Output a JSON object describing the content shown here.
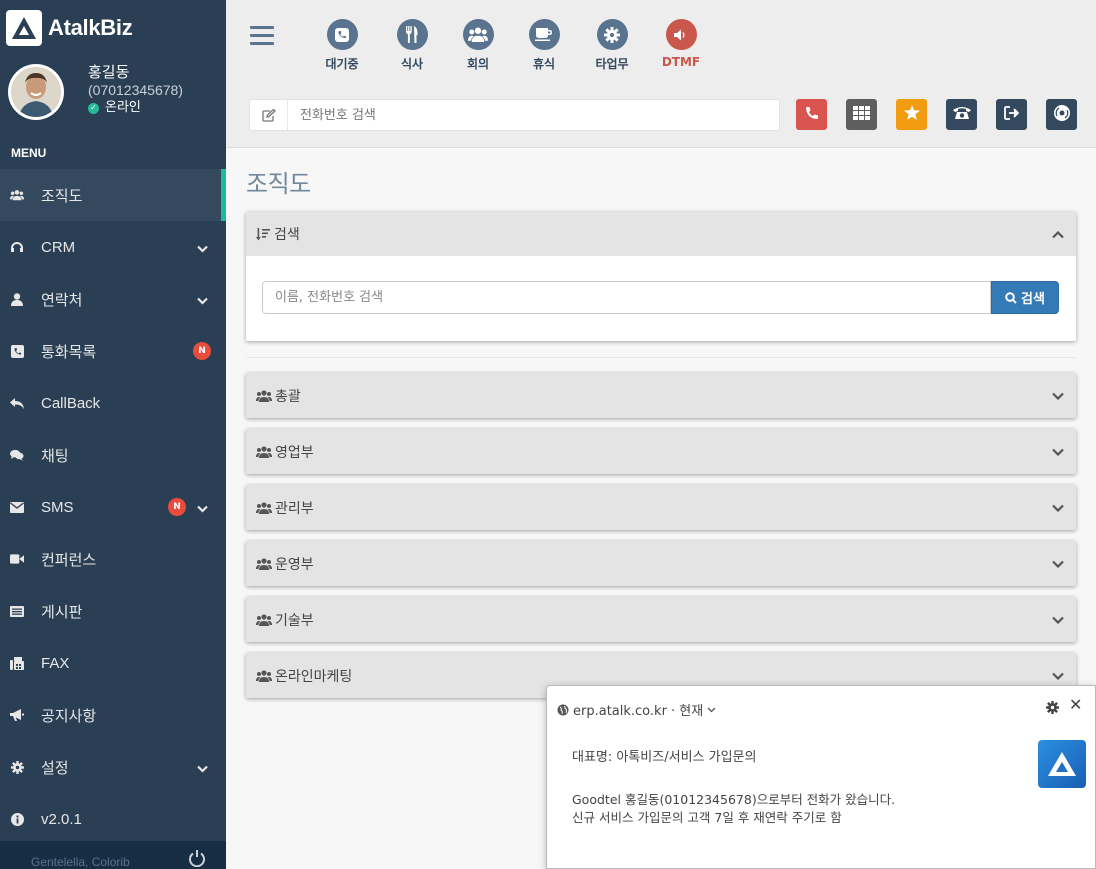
{
  "brand": {
    "name": "AtalkBiz"
  },
  "profile": {
    "name": "홍길동",
    "phone": "(07012345678)",
    "status": "온라인"
  },
  "menu": {
    "title": "MENU",
    "items": [
      {
        "label": "조직도",
        "icon": "users-icon",
        "active": true
      },
      {
        "label": "CRM",
        "icon": "headset-icon",
        "chevron": true
      },
      {
        "label": "연락처",
        "icon": "user-icon",
        "chevron": true
      },
      {
        "label": "통화목록",
        "icon": "phone-square-icon",
        "badge": "N"
      },
      {
        "label": "CallBack",
        "icon": "reply-icon"
      },
      {
        "label": "채팅",
        "icon": "comments-icon"
      },
      {
        "label": "SMS",
        "icon": "envelope-icon",
        "badge": "N",
        "chevron": true
      },
      {
        "label": "컨퍼런스",
        "icon": "video-icon"
      },
      {
        "label": "게시판",
        "icon": "list-alt-icon"
      },
      {
        "label": "FAX",
        "icon": "fax-icon"
      },
      {
        "label": "공지사항",
        "icon": "bullhorn-icon"
      },
      {
        "label": "설정",
        "icon": "gear-icon",
        "chevron": true
      },
      {
        "label": "v2.0.1",
        "icon": "info-icon"
      }
    ]
  },
  "footer": {
    "text": "Gentelella, Colorib"
  },
  "statuses": [
    {
      "label": "대기중",
      "icon": "phone-icon"
    },
    {
      "label": "식사",
      "icon": "cutlery-icon"
    },
    {
      "label": "회의",
      "icon": "users-icon"
    },
    {
      "label": "휴식",
      "icon": "coffee-icon"
    },
    {
      "label": "타업무",
      "icon": "gear-icon"
    },
    {
      "label": "DTMF",
      "icon": "volume-icon",
      "color": "#c9574c"
    }
  ],
  "phone_search": {
    "placeholder": "전화번호 검색"
  },
  "toolbar": [
    {
      "name": "call-button",
      "icon": "phone-icon",
      "color": "#d9534f"
    },
    {
      "name": "keypad-button",
      "icon": "grid-icon",
      "color": "#5e5e5e"
    },
    {
      "name": "favorite-button",
      "icon": "star-icon",
      "color": "#f39c12"
    },
    {
      "name": "transfer-button",
      "icon": "telephone-icon",
      "color": "#34495e"
    },
    {
      "name": "exit-button",
      "icon": "sign-out-icon",
      "color": "#34495e"
    },
    {
      "name": "record-button",
      "icon": "disc-icon",
      "color": "#34495e"
    }
  ],
  "page": {
    "title": "조직도"
  },
  "search_panel": {
    "title": "검색",
    "placeholder": "이름, 전화번호 검색",
    "button": "검색"
  },
  "departments": [
    "총괄",
    "영업부",
    "관리부",
    "운영부",
    "기술부",
    "온라인마케팅"
  ],
  "notification": {
    "origin": "erp.atalk.co.kr · 현재",
    "title": "대표명: 아톡비즈/서비스 가입문의",
    "line1": "Goodtel 홍길동(01012345678)으로부터 전화가 왔습니다.",
    "line2": "신규 서비스 가입문의 고객 7일 후 재연락 주기로 함"
  },
  "colors": {
    "sidebar": "#2a3f54",
    "accent": "#1abb9c",
    "primary": "#337ab7",
    "badge": "#e74c3c"
  }
}
